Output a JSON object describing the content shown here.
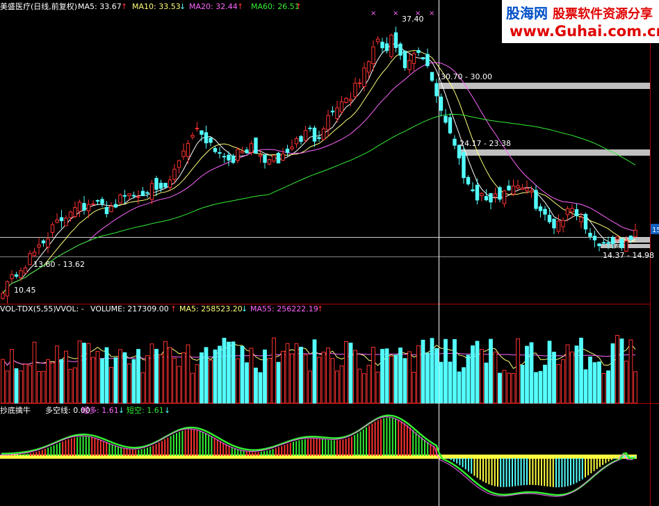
{
  "main": {
    "header": {
      "stock": "美盛医疗(日线,前复权)",
      "ma5": {
        "label": "MA5: 33.67",
        "arrow": "↑",
        "color": "#ffffff"
      },
      "ma10": {
        "label": "MA10: 33.53",
        "arrow": "↓",
        "color": "#ffff7a"
      },
      "ma20": {
        "label": "MA20: 32.44",
        "arrow": "↑",
        "color": "#ff66ff"
      },
      "ma60": {
        "label": "MA60: 26.51",
        "arrow": "↑",
        "color": "#33ee33"
      }
    },
    "annotations": {
      "high": "37.40",
      "low": "10.45",
      "zone1": "13.60 - 13.62",
      "zone2": "30.70 - 30.00",
      "zone3": "24.17 - 23.38",
      "zone4": "14.37 - 14.98",
      "zone5": "14.",
      "price_tag": "15"
    },
    "markers": [
      "×",
      "×",
      "×",
      "×"
    ]
  },
  "volume": {
    "header": {
      "title": "VOL-TDX(5,55)",
      "vvol": "VVOL: -",
      "volume": "VOLUME: 217309.00",
      "volume_arrow": "↑",
      "ma5": "MA5: 258523.20",
      "ma5_arrow": "↓",
      "ma55": "MA55: 256222.19",
      "ma55_arrow": "↑"
    }
  },
  "indicator": {
    "header": {
      "title": "抄底擒牛",
      "line": "多空线: 0.00",
      "short_long": "短多: 1.61",
      "short_long_arrow": "↓",
      "short_short": "短空: 1.61",
      "short_short_arrow": "↓"
    }
  },
  "watermark": {
    "brand": "股海网",
    "slogan": "股票软件资源分享",
    "url": "www.Guhai.com.cn"
  },
  "colors": {
    "up": "#ff3232",
    "down": "#54ffff",
    "ma5": "#ffffff",
    "ma10": "#ffff7a",
    "ma20": "#ff66ff",
    "ma60": "#33ee33",
    "zone": "#c0c0c0"
  },
  "chart_data": {
    "type": "candlestick",
    "title": "美盛医疗(日线,前复权)",
    "ylim": [
      10,
      39
    ],
    "price_path": [
      [
        0,
        10.8
      ],
      [
        4,
        10.45
      ],
      [
        10,
        11.0
      ],
      [
        18,
        11.6
      ],
      [
        25,
        12.0
      ],
      [
        32,
        12.5
      ],
      [
        38,
        13.0
      ],
      [
        45,
        13.6
      ],
      [
        55,
        14.8
      ],
      [
        65,
        15.6
      ],
      [
        75,
        16.6
      ],
      [
        85,
        17.2
      ],
      [
        95,
        18.0
      ],
      [
        105,
        19.0
      ],
      [
        115,
        19.6
      ],
      [
        125,
        18.6
      ],
      [
        135,
        19.2
      ],
      [
        145,
        19.0
      ],
      [
        155,
        18.6
      ],
      [
        165,
        19.2
      ],
      [
        175,
        19.8
      ],
      [
        185,
        20.3
      ],
      [
        195,
        20.0
      ],
      [
        205,
        20.6
      ],
      [
        215,
        21.0
      ],
      [
        225,
        20.2
      ],
      [
        235,
        20.6
      ],
      [
        245,
        21.4
      ],
      [
        255,
        23.5
      ],
      [
        265,
        25.0
      ],
      [
        275,
        26.4
      ],
      [
        285,
        27.0
      ],
      [
        295,
        26.2
      ],
      [
        305,
        25.4
      ],
      [
        315,
        24.6
      ],
      [
        325,
        24.2
      ],
      [
        335,
        24.0
      ],
      [
        345,
        24.4
      ],
      [
        355,
        25.0
      ],
      [
        365,
        24.8
      ],
      [
        375,
        24.0
      ],
      [
        385,
        23.8
      ],
      [
        395,
        23.6
      ],
      [
        405,
        24.0
      ],
      [
        415,
        24.8
      ],
      [
        425,
        25.6
      ],
      [
        435,
        26.2
      ],
      [
        445,
        26.8
      ],
      [
        455,
        26.0
      ],
      [
        465,
        27.4
      ],
      [
        475,
        28.6
      ],
      [
        485,
        29.5
      ],
      [
        495,
        30.0
      ],
      [
        505,
        30.6
      ],
      [
        515,
        31.6
      ],
      [
        525,
        33.2
      ],
      [
        535,
        35.2
      ],
      [
        545,
        36.0
      ],
      [
        555,
        35.0
      ],
      [
        565,
        36.6
      ],
      [
        575,
        34.2
      ],
      [
        585,
        33.4
      ],
      [
        595,
        34.4
      ],
      [
        605,
        34.8
      ],
      [
        615,
        33.2
      ],
      [
        625,
        31.4
      ],
      [
        635,
        29.0
      ],
      [
        645,
        27.2
      ],
      [
        655,
        25.0
      ],
      [
        665,
        22.8
      ],
      [
        675,
        21.0
      ],
      [
        685,
        20.2
      ],
      [
        695,
        20.0
      ],
      [
        705,
        19.4
      ],
      [
        715,
        19.8
      ],
      [
        725,
        20.6
      ],
      [
        735,
        21.0
      ],
      [
        745,
        21.4
      ],
      [
        755,
        20.8
      ],
      [
        765,
        20.0
      ],
      [
        775,
        18.8
      ],
      [
        785,
        17.6
      ],
      [
        795,
        17.0
      ],
      [
        805,
        17.6
      ],
      [
        815,
        18.2
      ],
      [
        825,
        19.0
      ],
      [
        835,
        17.8
      ],
      [
        845,
        16.4
      ],
      [
        855,
        15.6
      ],
      [
        865,
        14.8
      ],
      [
        875,
        15.4
      ],
      [
        885,
        15.2
      ],
      [
        895,
        15.0
      ],
      [
        905,
        15.2
      ],
      [
        915,
        16.2
      ]
    ],
    "volume_ylim": [
      0,
      600000
    ],
    "volume_summary": {
      "volume": 217309.0,
      "ma5": 258523.2,
      "ma55": 256222.19
    }
  }
}
